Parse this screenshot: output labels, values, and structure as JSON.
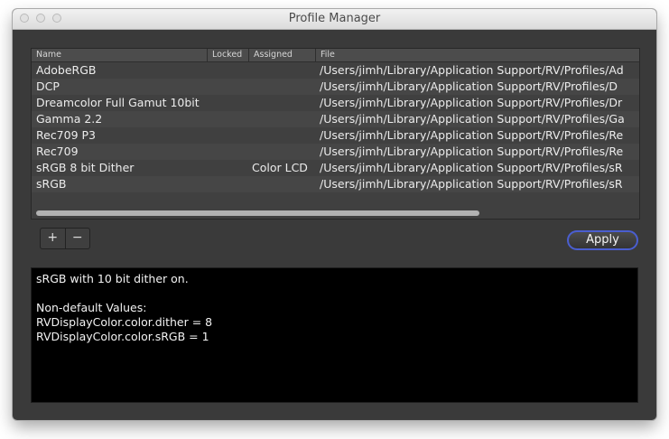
{
  "window": {
    "title": "Profile Manager"
  },
  "table": {
    "columns": [
      "Name",
      "Locked",
      "Assigned",
      "File"
    ],
    "rows": [
      {
        "name": "AdobeRGB",
        "locked": "",
        "assigned": "",
        "file": "/Users/jimh/Library/Application Support/RV/Profiles/Ad"
      },
      {
        "name": "DCP",
        "locked": "",
        "assigned": "",
        "file": "/Users/jimh/Library/Application Support/RV/Profiles/D"
      },
      {
        "name": "Dreamcolor Full Gamut 10bit",
        "locked": "",
        "assigned": "",
        "file": "/Users/jimh/Library/Application Support/RV/Profiles/Dr"
      },
      {
        "name": "Gamma 2.2",
        "locked": "",
        "assigned": "",
        "file": "/Users/jimh/Library/Application Support/RV/Profiles/Ga"
      },
      {
        "name": "Rec709 P3",
        "locked": "",
        "assigned": "",
        "file": "/Users/jimh/Library/Application Support/RV/Profiles/Re"
      },
      {
        "name": "Rec709",
        "locked": "",
        "assigned": "",
        "file": "/Users/jimh/Library/Application Support/RV/Profiles/Re"
      },
      {
        "name": "sRGB 8 bit Dither",
        "locked": "",
        "assigned": "Color LCD",
        "file": "/Users/jimh/Library/Application Support/RV/Profiles/sR"
      },
      {
        "name": "sRGB",
        "locked": "",
        "assigned": "",
        "file": "/Users/jimh/Library/Application Support/RV/Profiles/sR"
      }
    ]
  },
  "buttons": {
    "add_label": "+",
    "remove_label": "−",
    "apply_label": "Apply"
  },
  "description": {
    "lines": [
      "sRGB with 10 bit dither on.",
      "",
      "Non-default Values:",
      "RVDisplayColor.color.dither = 8",
      "RVDisplayColor.color.sRGB = 1"
    ]
  },
  "colors": {
    "window_bg": "#3a3a3a",
    "apply_focus_ring": "#4a5ed0",
    "description_bg": "#000000"
  }
}
